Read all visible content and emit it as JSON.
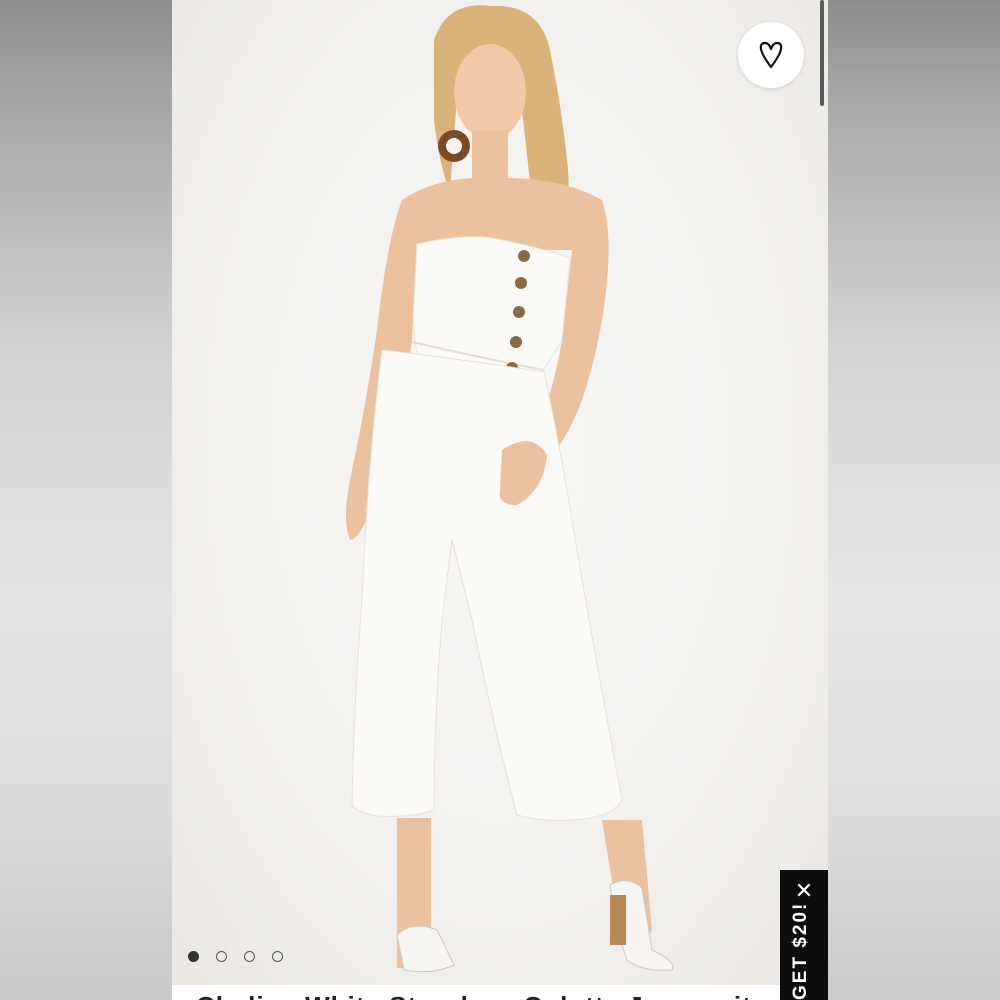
{
  "listing": {
    "title_partial": "Chelina White Strapless Culotte Jumpsuit",
    "image_alt": "White strapless button-front culotte jumpsuit"
  },
  "carousel": {
    "total_images": 4,
    "active_index": 0
  },
  "wishlist": {
    "icon": "heart-icon"
  },
  "promo": {
    "text": "GET $20!",
    "close_icon": "close-icon",
    "close_glyph": "✕"
  },
  "colors": {
    "promo_bg": "#0d0d0d",
    "photo_bg": "#f3f1ee",
    "garment": "#fbfaf6",
    "buttons": "#8a6a45"
  }
}
